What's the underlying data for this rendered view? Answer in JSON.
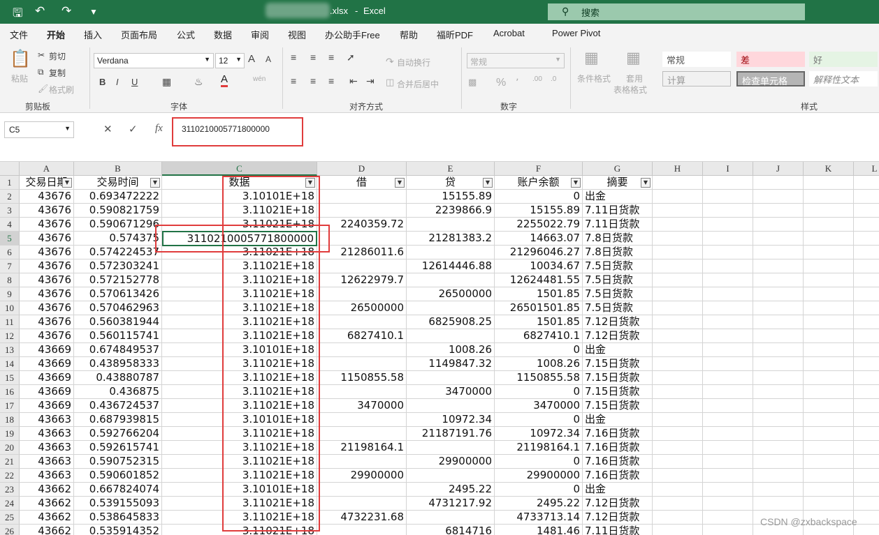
{
  "titlebar": {
    "filename": ".xlsx",
    "separator": "-",
    "app": "Excel",
    "search": "搜索",
    "undo_icon": "undo-icon",
    "redo_icon": "redo-icon",
    "save_icon": "save-icon"
  },
  "tabs": [
    "文件",
    "开始",
    "插入",
    "页面布局",
    "公式",
    "数据",
    "审阅",
    "视图",
    "办公助手Free",
    "帮助",
    "福昕PDF",
    "Acrobat",
    "Power Pivot"
  ],
  "ribbon": {
    "paste": "粘贴",
    "cut": "剪切",
    "copy": "复制",
    "format_painter": "格式刷",
    "clipboard_group": "剪贴板",
    "font_name": "Verdana",
    "font_size": "12",
    "font_group": "字体",
    "bold": "B",
    "italic": "I",
    "underline": "U",
    "font_grow": "A",
    "font_shrink": "A",
    "wrap_text": "自动换行",
    "merge_center": "合并后居中",
    "align_group": "对齐方式",
    "number_format": "常规",
    "percent": "%",
    "number_group": "数字",
    "cond_format": "条件格式",
    "table_format_1": "套用",
    "table_format_2": "表格格式",
    "styles_group": "样式",
    "styles": [
      "常规",
      "差",
      "好",
      "计算",
      "检查单元格",
      "解释性文本"
    ]
  },
  "formula_bar": {
    "name_box": "C5",
    "fx": "fx",
    "value": "3110210005771800000"
  },
  "columns": [
    "A",
    "B",
    "C",
    "D",
    "E",
    "F",
    "G",
    "H",
    "I",
    "J",
    "K",
    "L"
  ],
  "headers": [
    "交易日期",
    "交易时间",
    "数据",
    "借",
    "贷",
    "账户余额",
    "摘要"
  ],
  "rows": [
    [
      "1"
    ],
    [
      "2",
      "43676",
      "0.693472222",
      "3.10101E+18",
      "",
      "15155.89",
      "0",
      "出金"
    ],
    [
      "3",
      "43676",
      "0.590821759",
      "3.11021E+18",
      "",
      "2239866.9",
      "15155.89",
      "7.11日货款"
    ],
    [
      "4",
      "43676",
      "0.590671296",
      "3.11021E+18",
      "2240359.72",
      "",
      "2255022.79",
      "7.11日货款"
    ],
    [
      "5",
      "43676",
      "0.574375",
      "3110210005771800000",
      "",
      "21281383.2",
      "14663.07",
      "7.8日货款"
    ],
    [
      "6",
      "43676",
      "0.574224537",
      "3.11021E+18",
      "21286011.6",
      "",
      "21296046.27",
      "7.8日货款"
    ],
    [
      "7",
      "43676",
      "0.572303241",
      "3.11021E+18",
      "",
      "12614446.88",
      "10034.67",
      "7.5日货款"
    ],
    [
      "8",
      "43676",
      "0.572152778",
      "3.11021E+18",
      "12622979.7",
      "",
      "12624481.55",
      "7.5日货款"
    ],
    [
      "9",
      "43676",
      "0.570613426",
      "3.11021E+18",
      "",
      "26500000",
      "1501.85",
      "7.5日货款"
    ],
    [
      "10",
      "43676",
      "0.570462963",
      "3.11021E+18",
      "26500000",
      "",
      "26501501.85",
      "7.5日货款"
    ],
    [
      "11",
      "43676",
      "0.560381944",
      "3.11021E+18",
      "",
      "6825908.25",
      "1501.85",
      "7.12日货款"
    ],
    [
      "12",
      "43676",
      "0.560115741",
      "3.11021E+18",
      "6827410.1",
      "",
      "6827410.1",
      "7.12日货款"
    ],
    [
      "13",
      "43669",
      "0.674849537",
      "3.10101E+18",
      "",
      "1008.26",
      "0",
      "出金"
    ],
    [
      "14",
      "43669",
      "0.438958333",
      "3.11021E+18",
      "",
      "1149847.32",
      "1008.26",
      "7.15日货款"
    ],
    [
      "15",
      "43669",
      "0.43880787",
      "3.11021E+18",
      "1150855.58",
      "",
      "1150855.58",
      "7.15日货款"
    ],
    [
      "16",
      "43669",
      "0.436875",
      "3.11021E+18",
      "",
      "3470000",
      "0",
      "7.15日货款"
    ],
    [
      "17",
      "43669",
      "0.436724537",
      "3.11021E+18",
      "3470000",
      "",
      "3470000",
      "7.15日货款"
    ],
    [
      "18",
      "43663",
      "0.687939815",
      "3.10101E+18",
      "",
      "10972.34",
      "0",
      "出金"
    ],
    [
      "19",
      "43663",
      "0.592766204",
      "3.11021E+18",
      "",
      "21187191.76",
      "10972.34",
      "7.16日货款"
    ],
    [
      "20",
      "43663",
      "0.592615741",
      "3.11021E+18",
      "21198164.1",
      "",
      "21198164.1",
      "7.16日货款"
    ],
    [
      "21",
      "43663",
      "0.590752315",
      "3.11021E+18",
      "",
      "29900000",
      "0",
      "7.16日货款"
    ],
    [
      "22",
      "43663",
      "0.590601852",
      "3.11021E+18",
      "29900000",
      "",
      "29900000",
      "7.16日货款"
    ],
    [
      "23",
      "43662",
      "0.667824074",
      "3.10101E+18",
      "",
      "2495.22",
      "0",
      "出金"
    ],
    [
      "24",
      "43662",
      "0.539155093",
      "3.11021E+18",
      "",
      "4731217.92",
      "2495.22",
      "7.12日货款"
    ],
    [
      "25",
      "43662",
      "0.538645833",
      "3.11021E+18",
      "4732231.68",
      "",
      "4733713.14",
      "7.12日货款"
    ],
    [
      "26",
      "43662",
      "0.535914352",
      "3.11021E+18",
      "",
      "6814716",
      "1481.46",
      "7.11日货款"
    ]
  ],
  "watermark": "CSDN @zxbackspace"
}
